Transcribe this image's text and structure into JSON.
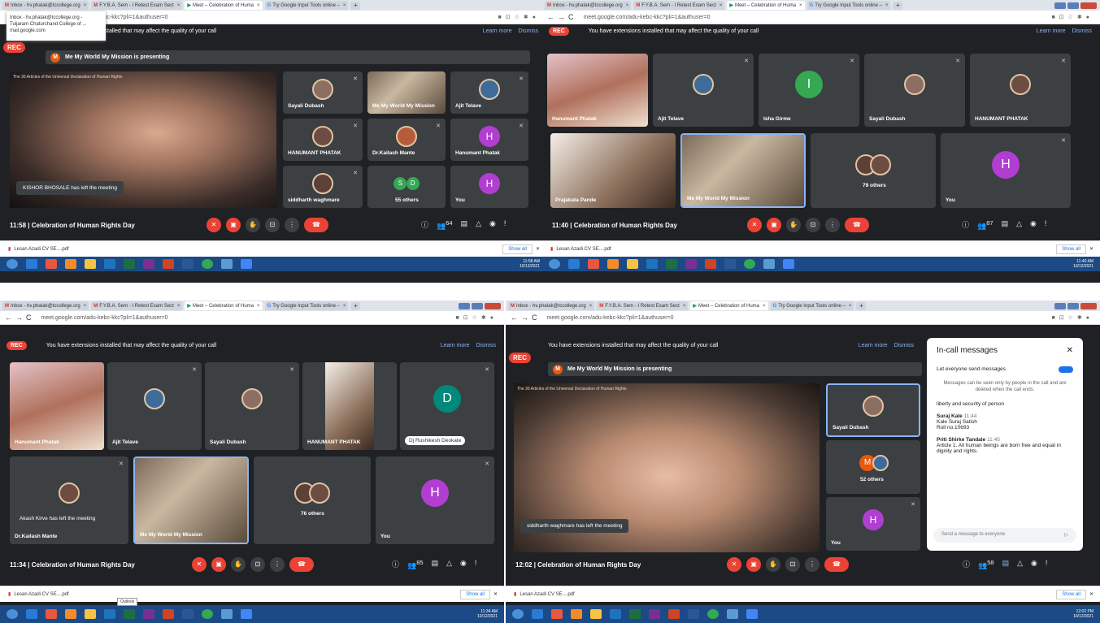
{
  "tabs": {
    "t1": "Inbox - hv.phatak@tccollege.org",
    "t2": "F.Y.B.A. Sem - I Retest Exam Sect",
    "t3": "Meet – Celebration of Huma",
    "t4": "Try Google Input Tools online –"
  },
  "url": "meet.google.com/adu-kebc-kkc?pli=1&authuser=0",
  "banner": {
    "rec": "REC",
    "msg": "You have extensions installed that may affect the quality of your call",
    "learn": "Learn more",
    "dismiss": "Dismiss"
  },
  "presenting": {
    "avatar": "M",
    "text": "Me My World My Mission is presenting"
  },
  "video_title": "The 30 Articles of the Universal Declaration of Human Rights",
  "meeting": "Celebration of Human Rights Day",
  "popup": {
    "l1": "Inbox - hv.phatak@tccollege.org -",
    "l2": "Tuljaram Chaturchand College of ...",
    "l3": "mail.google.com"
  },
  "q1": {
    "time": "11:58",
    "toast": "KISHOR BHOSALE has left the meeting",
    "names": [
      "Sayali Dubash",
      "Me My World My Mission",
      "Ajit Telave",
      "HANUMANT PHATAK",
      "Dr.Kailash Mante",
      "Hanumant Phatak",
      "siddharth waghmare",
      "55 others",
      "You"
    ],
    "letters": [
      "H",
      "S",
      "D",
      "H"
    ]
  },
  "q2": {
    "time": "11:40",
    "names": [
      "Hanumant Phatak",
      "Ajit Telave",
      "Isha Girme",
      "Sayali Dubash",
      "HANUMANT PHATAK",
      "Prajakata Pande",
      "Me My World My Mission",
      "79 others",
      "You"
    ],
    "letters": [
      "I",
      "H"
    ]
  },
  "q3": {
    "time": "11:34",
    "toast": "Akash Kirve has left the meeting",
    "names": [
      "Hanumant Phatak",
      "Ajit Telave",
      "Sayali Dubash",
      "HANUMANT PHATAK",
      "Dj Rushikesh Deokate",
      "Dr.Kailash Mante",
      "Me My World My Mission",
      "76 others",
      "You"
    ],
    "letters": [
      "D",
      "H"
    ]
  },
  "q4": {
    "time": "12:02",
    "toast": "siddharth waghmare has left the meeting",
    "names": [
      "Sayali Dubash",
      "52 others",
      "You"
    ],
    "letters": [
      "M",
      "H"
    ]
  },
  "chat": {
    "title": "In-call messages",
    "toggle": "Let everyone send messages",
    "note": "Messages can be seen only by people in the call and are deleted when the call ends.",
    "m0": "liberty and security of person",
    "u1": "Suraj Kale",
    "t1": "11:44",
    "m1a": "Kale Suraj Satish",
    "m1b": "Roll no.10693",
    "u2": "Priti Shirke Tandale",
    "t2": "11:45",
    "m2": "Article 1. All human beings are born free and equal in dignity and rights.",
    "placeholder": "Send a message to everyone"
  },
  "download": {
    "file": "Lesan Azadi CV SE....pdf",
    "show_all": "Show all"
  },
  "tooltip": "Outlook",
  "clocks": [
    {
      "time": "11:58 AM",
      "date": "10/12/2021"
    },
    {
      "time": "11:40 AM",
      "date": "10/12/2021"
    },
    {
      "time": "11:34 AM",
      "date": "10/12/2021"
    },
    {
      "time": "12:02 PM",
      "date": "10/12/2021"
    }
  ],
  "badges": {
    "q1": "64",
    "q2": "87",
    "q3": "85",
    "q4": "58"
  },
  "colors": {
    "meet_bg": "#202124",
    "tile": "#3c4043",
    "red": "#ea4335",
    "purple": "#b13ed1",
    "green": "#34a853",
    "blue": "#1a73e8"
  }
}
